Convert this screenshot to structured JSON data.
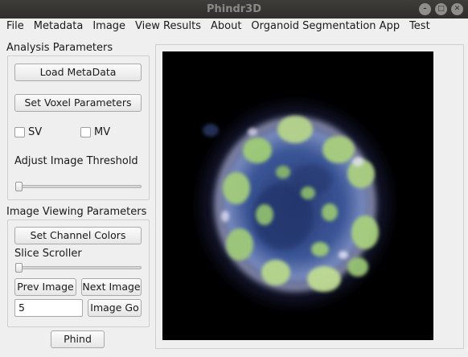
{
  "window": {
    "title": "Phindr3D",
    "controls": [
      "minimize-icon",
      "maximize-icon",
      "close-icon"
    ]
  },
  "menubar": {
    "items": [
      "File",
      "Metadata",
      "Image",
      "View Results",
      "About",
      "Organoid Segmentation App",
      "Test"
    ]
  },
  "analysis": {
    "title": "Analysis Parameters",
    "load_metadata": "Load MetaData",
    "set_voxel": "Set Voxel Parameters",
    "sv_label": "SV",
    "mv_label": "MV",
    "sv_checked": false,
    "mv_checked": false,
    "threshold_label": "Adjust Image Threshold",
    "threshold_value": 0
  },
  "viewing": {
    "title": "Image Viewing Parameters",
    "set_channel_colors": "Set Channel Colors",
    "slice_label": "Slice Scroller",
    "slice_value": 0,
    "prev_image": "Prev Image",
    "next_image": "Next Image",
    "image_number": "5",
    "image_go": "Image Go"
  },
  "phind_button": "Phind",
  "colors": {
    "titlebar": "#3e3d39",
    "panel_bg": "#efefef",
    "image_bg": "#000000",
    "organoid_green": "#b4d68a",
    "organoid_blue": "#2f4a86"
  }
}
